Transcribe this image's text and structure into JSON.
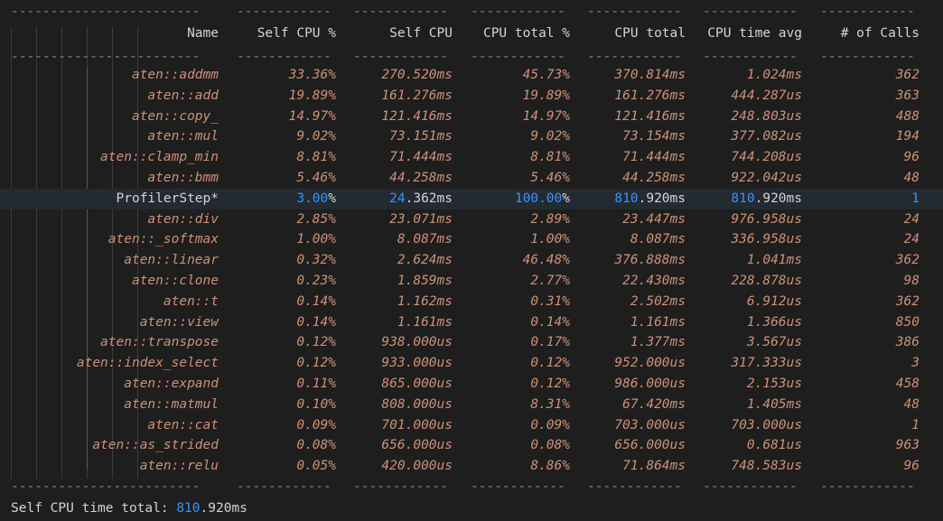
{
  "columns": {
    "name": "Name",
    "self_cpu_pct": "Self CPU %",
    "self_cpu": "Self CPU",
    "cpu_total_pct": "CPU total %",
    "cpu_total": "CPU total",
    "cpu_time_avg": "CPU time avg",
    "num_calls": "# of Calls"
  },
  "dash_line_name": "------------------------",
  "dash_line_col": "------------",
  "rows": [
    {
      "name": "aten::addmm",
      "self_cpu_pct": "33.36%",
      "self_cpu": "270.520ms",
      "cpu_total_pct": "45.73%",
      "cpu_total": "370.814ms",
      "cpu_time_avg": "1.024ms",
      "num_calls": "362"
    },
    {
      "name": "aten::add",
      "self_cpu_pct": "19.89%",
      "self_cpu": "161.276ms",
      "cpu_total_pct": "19.89%",
      "cpu_total": "161.276ms",
      "cpu_time_avg": "444.287us",
      "num_calls": "363"
    },
    {
      "name": "aten::copy_",
      "self_cpu_pct": "14.97%",
      "self_cpu": "121.416ms",
      "cpu_total_pct": "14.97%",
      "cpu_total": "121.416ms",
      "cpu_time_avg": "248.803us",
      "num_calls": "488"
    },
    {
      "name": "aten::mul",
      "self_cpu_pct": "9.02%",
      "self_cpu": "73.151ms",
      "cpu_total_pct": "9.02%",
      "cpu_total": "73.154ms",
      "cpu_time_avg": "377.082us",
      "num_calls": "194"
    },
    {
      "name": "aten::clamp_min",
      "self_cpu_pct": "8.81%",
      "self_cpu": "71.444ms",
      "cpu_total_pct": "8.81%",
      "cpu_total": "71.444ms",
      "cpu_time_avg": "744.208us",
      "num_calls": "96"
    },
    {
      "name": "aten::bmm",
      "self_cpu_pct": "5.46%",
      "self_cpu": "44.258ms",
      "cpu_total_pct": "5.46%",
      "cpu_total": "44.258ms",
      "cpu_time_avg": "922.042us",
      "num_calls": "48"
    },
    {
      "name": "aten::div",
      "self_cpu_pct": "2.85%",
      "self_cpu": "23.071ms",
      "cpu_total_pct": "2.89%",
      "cpu_total": "23.447ms",
      "cpu_time_avg": "976.958us",
      "num_calls": "24"
    },
    {
      "name": "aten::_softmax",
      "self_cpu_pct": "1.00%",
      "self_cpu": "8.087ms",
      "cpu_total_pct": "1.00%",
      "cpu_total": "8.087ms",
      "cpu_time_avg": "336.958us",
      "num_calls": "24"
    },
    {
      "name": "aten::linear",
      "self_cpu_pct": "0.32%",
      "self_cpu": "2.624ms",
      "cpu_total_pct": "46.48%",
      "cpu_total": "376.888ms",
      "cpu_time_avg": "1.041ms",
      "num_calls": "362"
    },
    {
      "name": "aten::clone",
      "self_cpu_pct": "0.23%",
      "self_cpu": "1.859ms",
      "cpu_total_pct": "2.77%",
      "cpu_total": "22.430ms",
      "cpu_time_avg": "228.878us",
      "num_calls": "98"
    },
    {
      "name": "aten::t",
      "self_cpu_pct": "0.14%",
      "self_cpu": "1.162ms",
      "cpu_total_pct": "0.31%",
      "cpu_total": "2.502ms",
      "cpu_time_avg": "6.912us",
      "num_calls": "362"
    },
    {
      "name": "aten::view",
      "self_cpu_pct": "0.14%",
      "self_cpu": "1.161ms",
      "cpu_total_pct": "0.14%",
      "cpu_total": "1.161ms",
      "cpu_time_avg": "1.366us",
      "num_calls": "850"
    },
    {
      "name": "aten::transpose",
      "self_cpu_pct": "0.12%",
      "self_cpu": "938.000us",
      "cpu_total_pct": "0.17%",
      "cpu_total": "1.377ms",
      "cpu_time_avg": "3.567us",
      "num_calls": "386"
    },
    {
      "name": "aten::index_select",
      "self_cpu_pct": "0.12%",
      "self_cpu": "933.000us",
      "cpu_total_pct": "0.12%",
      "cpu_total": "952.000us",
      "cpu_time_avg": "317.333us",
      "num_calls": "3"
    },
    {
      "name": "aten::expand",
      "self_cpu_pct": "0.11%",
      "self_cpu": "865.000us",
      "cpu_total_pct": "0.12%",
      "cpu_total": "986.000us",
      "cpu_time_avg": "2.153us",
      "num_calls": "458"
    },
    {
      "name": "aten::matmul",
      "self_cpu_pct": "0.10%",
      "self_cpu": "808.000us",
      "cpu_total_pct": "8.31%",
      "cpu_total": "67.420ms",
      "cpu_time_avg": "1.405ms",
      "num_calls": "48"
    },
    {
      "name": "aten::cat",
      "self_cpu_pct": "0.09%",
      "self_cpu": "701.000us",
      "cpu_total_pct": "0.09%",
      "cpu_total": "703.000us",
      "cpu_time_avg": "703.000us",
      "num_calls": "1"
    },
    {
      "name": "aten::as_strided",
      "self_cpu_pct": "0.08%",
      "self_cpu": "656.000us",
      "cpu_total_pct": "0.08%",
      "cpu_total": "656.000us",
      "cpu_time_avg": "0.681us",
      "num_calls": "963"
    },
    {
      "name": "aten::relu",
      "self_cpu_pct": "0.05%",
      "self_cpu": "420.000us",
      "cpu_total_pct": "8.86%",
      "cpu_total": "71.864ms",
      "cpu_time_avg": "748.583us",
      "num_calls": "96"
    }
  ],
  "highlight_row": {
    "name": "ProfilerStep*",
    "self_cpu_pct_num": "3.00",
    "self_cpu_pct_unit": "%",
    "self_cpu_num": "24",
    "self_cpu_rest": ".362ms",
    "cpu_total_pct_num": "100.00",
    "cpu_total_pct_unit": "%",
    "cpu_total_num": "810",
    "cpu_total_rest": ".920ms",
    "cpu_time_avg_num": "810",
    "cpu_time_avg_rest": ".920ms",
    "num_calls": "1"
  },
  "footer": {
    "label": "Self CPU time total: ",
    "value_num": "810",
    "value_rest": ".920ms"
  },
  "colors": {
    "background": "#1e1e1e",
    "value_text": "#ce9178",
    "header_text": "#d4d4d4",
    "accent_blue": "#3794ff",
    "highlight_bg": "#232a31"
  }
}
